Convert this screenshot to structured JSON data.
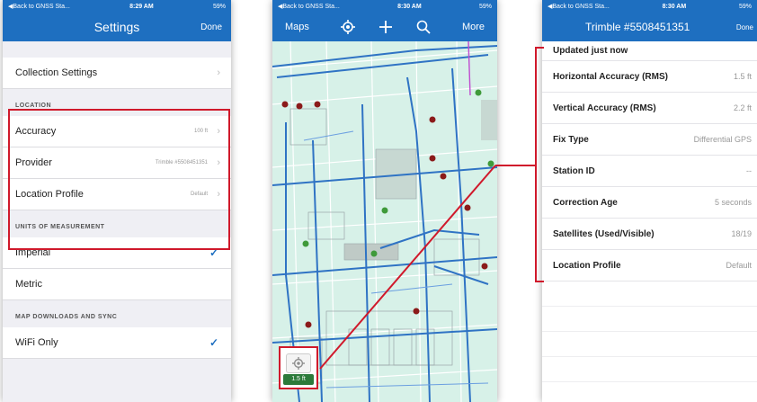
{
  "left_phone": {
    "status": {
      "back": "◀Back to GNSS Sta...",
      "time": "8:29 AM",
      "battery": "59%"
    },
    "nav": {
      "title": "Settings",
      "done": "Done"
    },
    "collection_settings": "Collection Settings",
    "location": {
      "header": "LOCATION",
      "accuracy": {
        "label": "Accuracy",
        "value": "100 ft"
      },
      "provider": {
        "label": "Provider",
        "value": "Trimble #5508451351"
      },
      "profile": {
        "label": "Location Profile",
        "value": "Default"
      }
    },
    "units": {
      "header": "UNITS OF MEASUREMENT",
      "imperial": "Imperial",
      "metric": "Metric"
    },
    "map_downloads": {
      "header": "MAP DOWNLOADS AND SYNC",
      "wifi": "WiFi Only"
    }
  },
  "middle_phone": {
    "status": {
      "back": "◀Back to GNSS Sta...",
      "time": "8:30 AM",
      "battery": "59%"
    },
    "nav": {
      "maps": "Maps",
      "more": "More"
    },
    "icons": [
      "locate-icon",
      "add-icon",
      "search-icon"
    ],
    "gps_accuracy": "1.5 ft"
  },
  "right_phone": {
    "status": {
      "back": "◀Back to GNSS Sta...",
      "time": "8:30 AM",
      "battery": "59%"
    },
    "nav": {
      "title": "Trimble #5508451351",
      "done": "Done"
    },
    "updated": "Updated just now",
    "rows": [
      {
        "label": "Horizontal Accuracy (RMS)",
        "value": "1.5 ft"
      },
      {
        "label": "Vertical Accuracy (RMS)",
        "value": "2.2 ft"
      },
      {
        "label": "Fix Type",
        "value": "Differential GPS"
      },
      {
        "label": "Station ID",
        "value": "--"
      },
      {
        "label": "Correction Age",
        "value": "5 seconds"
      },
      {
        "label": "Satellites (Used/Visible)",
        "value": "18/19"
      },
      {
        "label": "Location Profile",
        "value": "Default"
      }
    ]
  },
  "colors": {
    "nav_blue": "#1e6fc0",
    "highlight_red": "#d0192b",
    "map_green": "#2c7a3a"
  }
}
